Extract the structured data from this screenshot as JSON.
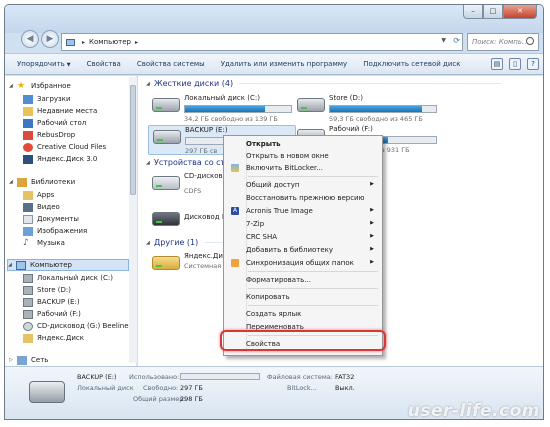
{
  "address": {
    "path": "Компьютер"
  },
  "search": {
    "placeholder": "Поиск: Компь..."
  },
  "toolbar": {
    "items": [
      "Упорядочить",
      "Свойства",
      "Свойства системы",
      "Удалить или изменить программу",
      "Подключить сетевой диск"
    ]
  },
  "nav": {
    "favorites": "Избранное",
    "fav_items": [
      "Загрузки",
      "Недавние места",
      "Рабочий стол",
      "RebusDrop",
      "Creative Cloud Files",
      "Яндекс.Диск 3.0"
    ],
    "libraries": "Библиотеки",
    "lib_items": [
      "Apps",
      "Видео",
      "Документы",
      "Изображения",
      "Музыка"
    ],
    "computer": "Компьютер",
    "comp_items": [
      "Локальный диск (C:)",
      "Store (D:)",
      "BACKUP (E:)",
      "Рабочий (F:)",
      "CD-дисковод (G:) Beeline",
      "Яндекс.Диск"
    ],
    "network": "Сеть"
  },
  "groups": {
    "hdd": "Жесткие диски (4)",
    "removable": "Устройства со съе",
    "other": "Другие (1)"
  },
  "drives": [
    {
      "name": "Локальный диск (C:)",
      "free": "34,2 ГБ свободно из 139 ГБ",
      "used": 0.75
    },
    {
      "name": "Store (D:)",
      "free": "59,3 ГБ свободно из 465 ГБ",
      "used": 0.87
    },
    {
      "name": "BACKUP (E:)",
      "free": "297 ГБ св",
      "used": 0.0
    },
    {
      "name": "Рабочий (F:)",
      "free": "из 931 ГБ",
      "used": 0.55
    }
  ],
  "removable": [
    {
      "name": "CD-дисковод",
      "sub": "CDFS"
    },
    {
      "name": "Дисковод BD-"
    }
  ],
  "other": [
    {
      "name": "Яндекс.Диск",
      "sub": "Системная па"
    }
  ],
  "context_menu": {
    "items": [
      {
        "label": "Открыть",
        "bold": true
      },
      {
        "label": "Открыть в новом окне"
      },
      {
        "label": "Включить BitLocker..."
      },
      {
        "label": "Общий доступ",
        "submenu": true
      },
      {
        "label": "Восстановить прежнюю версию"
      },
      {
        "label": "Acronis True Image",
        "submenu": true
      },
      {
        "label": "7-Zip",
        "submenu": true
      },
      {
        "label": "CRC SHA",
        "submenu": true
      },
      {
        "label": "Добавить в библиотеку",
        "submenu": true
      },
      {
        "label": "Синхронизация общих папок",
        "submenu": true
      },
      {
        "label": "Форматировать..."
      },
      {
        "label": "Копировать"
      },
      {
        "label": "Создать ярлык"
      },
      {
        "label": "Переименовать"
      },
      {
        "label": "Свойства"
      }
    ]
  },
  "details": {
    "name": "BACKUP (E:)",
    "type": "Локальный диск",
    "used_label": "Использовано:",
    "free_label": "Свободно:",
    "free_value": "297 ГБ",
    "total_label": "Общий размер:",
    "total_value": "298 ГБ",
    "fs_label": "Файловая система:",
    "fs_value": "FAT32",
    "bitlocker_label": "BitLock...",
    "bitlocker_value": "Выкл.",
    "used": 0.0
  },
  "watermark": "user-life.com",
  "colors": {
    "accent": "#1b72b4",
    "highlight": "#d93636"
  }
}
